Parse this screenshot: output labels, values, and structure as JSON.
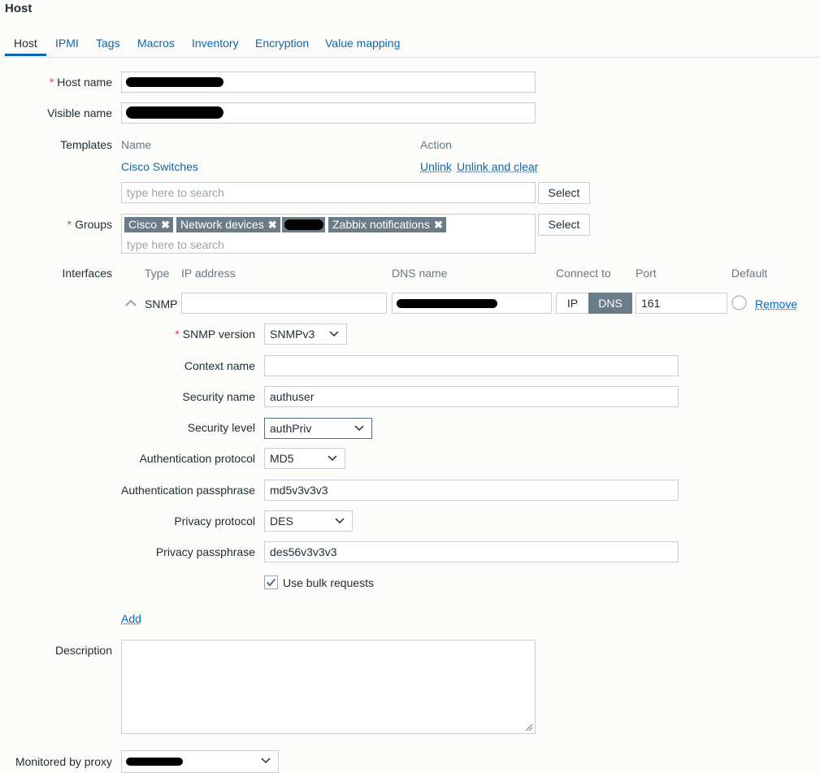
{
  "page": {
    "title": "Host"
  },
  "tabs": [
    {
      "label": "Host",
      "active": true
    },
    {
      "label": "IPMI"
    },
    {
      "label": "Tags"
    },
    {
      "label": "Macros"
    },
    {
      "label": "Inventory"
    },
    {
      "label": "Encryption"
    },
    {
      "label": "Value mapping"
    }
  ],
  "host_name": {
    "label": "Host name"
  },
  "visible_name": {
    "label": "Visible name"
  },
  "templates": {
    "label": "Templates",
    "col_name": "Name",
    "col_action": "Action",
    "rows": [
      {
        "name": "Cisco Switches",
        "unlink": "Unlink",
        "unlink_clear": "Unlink and clear"
      }
    ],
    "search_placeholder": "type here to search",
    "select_button": "Select"
  },
  "groups": {
    "label": "Groups",
    "chips": [
      "Cisco",
      "Network devices",
      "",
      "Zabbix notifications"
    ],
    "search_placeholder": "type here to search",
    "select_button": "Select"
  },
  "interfaces": {
    "label": "Interfaces",
    "col_type": "Type",
    "col_ip": "IP address",
    "col_dns": "DNS name",
    "col_connect": "Connect to",
    "col_port": "Port",
    "col_default": "Default",
    "row": {
      "type": "SNMP",
      "ip": "",
      "connect_ip": "IP",
      "connect_dns": "DNS",
      "connect_selected": "DNS",
      "port": "161",
      "remove": "Remove"
    },
    "add": "Add"
  },
  "snmp": {
    "version_label": "SNMP version",
    "version_value": "SNMPv3",
    "context_label": "Context name",
    "context_value": "",
    "security_name_label": "Security name",
    "security_name_value": "authuser",
    "security_level_label": "Security level",
    "security_level_value": "authPriv",
    "auth_protocol_label": "Authentication protocol",
    "auth_protocol_value": "MD5",
    "auth_pass_label": "Authentication passphrase",
    "auth_pass_value": "md5v3v3v3",
    "priv_protocol_label": "Privacy protocol",
    "priv_protocol_value": "DES",
    "priv_pass_label": "Privacy passphrase",
    "priv_pass_value": "des56v3v3v3",
    "bulk_label": "Use bulk requests",
    "bulk_checked": true
  },
  "description": {
    "label": "Description",
    "value": ""
  },
  "proxy": {
    "label": "Monitored by proxy"
  },
  "colors": {
    "accent": "#0b67b1",
    "chip": "#6b7c89",
    "required": "#d64541"
  }
}
